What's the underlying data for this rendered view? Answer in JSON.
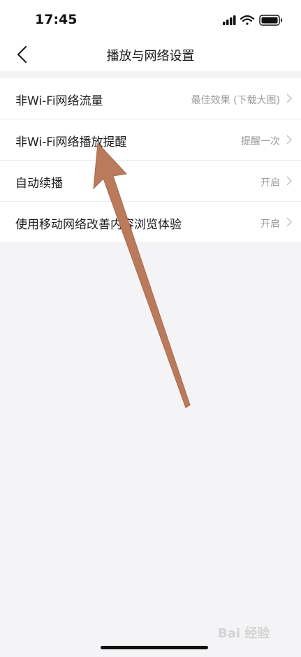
{
  "status_bar": {
    "time": "17:45"
  },
  "nav": {
    "title": "播放与网络设置"
  },
  "settings": [
    {
      "label": "非Wi-Fi网络流量",
      "value": "最佳效果 (下载大图)"
    },
    {
      "label": "非Wi-Fi网络播放提醒",
      "value": "提醒一次"
    },
    {
      "label": "自动续播",
      "value": "开启"
    },
    {
      "label": "使用移动网络改善内容浏览体验",
      "value": "开启"
    }
  ],
  "watermark": {
    "text": "Bai 经验"
  },
  "colors": {
    "background": "#f4f4f6",
    "surface": "#ffffff",
    "annotation_arrow": "#b97b5c"
  }
}
